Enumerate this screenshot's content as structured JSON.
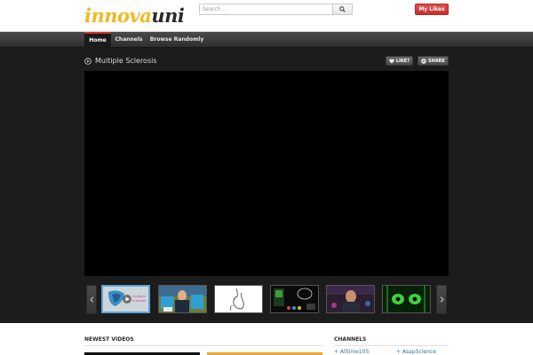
{
  "header": {
    "logo_part1": "innova",
    "logo_part2": "uni",
    "search_placeholder": "Search...",
    "mylikes_label": "My Likes"
  },
  "nav": {
    "items": [
      {
        "label": "Home",
        "active": true
      },
      {
        "label": "Channels",
        "active": false
      },
      {
        "label": "Browse Randomly",
        "active": false
      }
    ]
  },
  "video": {
    "title": "Multiple Sclerosis",
    "like_label": "LIKE?",
    "share_label": "SHARE"
  },
  "thumbnails": [
    {
      "name": "thumb-1",
      "caption": "multiple sclerosis",
      "active": true
    },
    {
      "name": "thumb-2",
      "active": false
    },
    {
      "name": "thumb-3",
      "active": false
    },
    {
      "name": "thumb-4",
      "active": false
    },
    {
      "name": "thumb-5",
      "active": false
    },
    {
      "name": "thumb-6",
      "active": false
    }
  ],
  "lower": {
    "newest_heading": "NEWEST VIDEOS",
    "channels_heading": "CHANNELS",
    "channel_links": [
      "+ Alltime105",
      "+ AsapScience"
    ]
  },
  "colors": {
    "accent_red": "#d43030",
    "logo_yellow": "#f1b820",
    "active_thumb_border": "#57a6d8",
    "link_blue": "#2f6fa8"
  }
}
